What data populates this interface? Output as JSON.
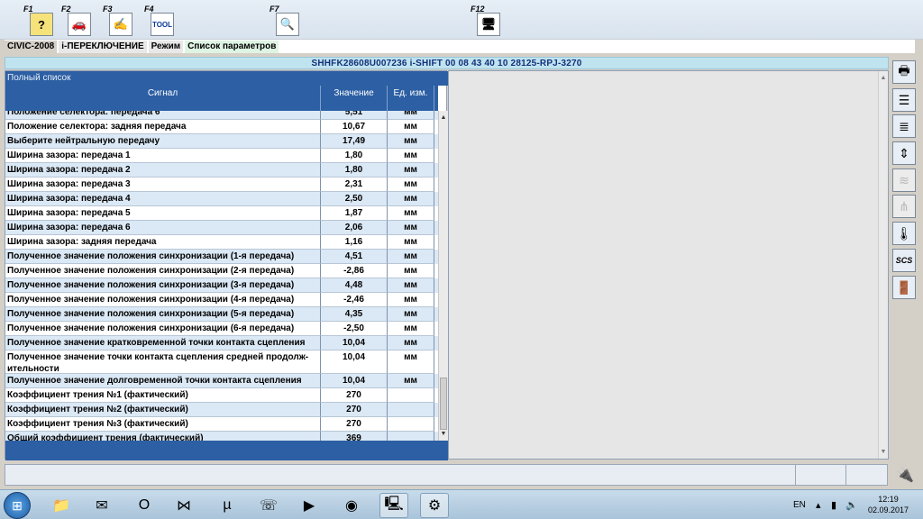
{
  "toolbar": {
    "keys": [
      {
        "label": "F1",
        "icon": "help-icon",
        "glyph": "?"
      },
      {
        "label": "F2",
        "icon": "car-icon",
        "glyph": "🚗"
      },
      {
        "label": "F3",
        "icon": "step-icon",
        "glyph": "✍"
      },
      {
        "label": "F4",
        "icon": "tool-icon",
        "glyph": "TOOL"
      },
      {
        "label": "F7",
        "icon": "test-icon",
        "glyph": "🔍"
      },
      {
        "label": "F12",
        "icon": "terminal-icon",
        "glyph": "🖥"
      }
    ]
  },
  "breadcrumb": {
    "model": "CIVIC-2008",
    "system": "i-ПЕРЕКЛЮЧЕНИЕ",
    "mode": "Режим",
    "page": "Список параметров"
  },
  "vin_line": "SHHFK28608U007236  i-SHIFT  00 08 43 40 10  28125-RPJ-3270",
  "list": {
    "title": "Полный список",
    "headers": {
      "signal": "Сигнал",
      "value": "Значение",
      "unit": "Ед. изм."
    },
    "rows": [
      {
        "signal": "Положение селектора: передача 6",
        "value": "5,51",
        "unit": "мм"
      },
      {
        "signal": "Положение селектора: задняя передача",
        "value": "10,67",
        "unit": "мм"
      },
      {
        "signal": "Выберите нейтральную передачу",
        "value": "17,49",
        "unit": "мм"
      },
      {
        "signal": "Ширина зазора: передача 1",
        "value": "1,80",
        "unit": "мм"
      },
      {
        "signal": "Ширина зазора: передача 2",
        "value": "1,80",
        "unit": "мм"
      },
      {
        "signal": "Ширина зазора: передача 3",
        "value": "2,31",
        "unit": "мм"
      },
      {
        "signal": "Ширина зазора: передача 4",
        "value": "2,50",
        "unit": "мм"
      },
      {
        "signal": "Ширина зазора: передача 5",
        "value": "1,87",
        "unit": "мм"
      },
      {
        "signal": "Ширина зазора: передача 6",
        "value": "2,06",
        "unit": "мм"
      },
      {
        "signal": "Ширина зазора: задняя передача",
        "value": "1,16",
        "unit": "мм"
      },
      {
        "signal": "Полученное значение положения синхронизации (1-я передача)",
        "value": "4,51",
        "unit": "мм"
      },
      {
        "signal": "Полученное значение положения синхронизации (2-я передача)",
        "value": "-2,86",
        "unit": "мм"
      },
      {
        "signal": "Полученное значение положения синхронизации (3-я передача)",
        "value": "4,48",
        "unit": "мм"
      },
      {
        "signal": "Полученное значение положения синхронизации (4-я передача)",
        "value": "-2,46",
        "unit": "мм"
      },
      {
        "signal": "Полученное значение положения синхронизации (5-я передача)",
        "value": "4,35",
        "unit": "мм"
      },
      {
        "signal": "Полученное значение положения синхронизации (6-я передача)",
        "value": "-2,50",
        "unit": "мм"
      },
      {
        "signal": "Полученное значение кратковременной точки контакта сцепления",
        "value": "10,04",
        "unit": "мм"
      },
      {
        "signal": "Полученное значение точки контакта сцепления средней продолж-ительности",
        "value": "10,04",
        "unit": "мм"
      },
      {
        "signal": "Полученное значение долговременной точки контакта сцепления",
        "value": "10,04",
        "unit": "мм"
      },
      {
        "signal": "Коэффициент трения №1 (фактический)",
        "value": "270",
        "unit": ""
      },
      {
        "signal": "Коэффициент трения №2 (фактический)",
        "value": "270",
        "unit": ""
      },
      {
        "signal": "Коэффициент трения №3 (фактический)",
        "value": "270",
        "unit": ""
      },
      {
        "signal": "Общий коэффициент трения (фактический)",
        "value": "369",
        "unit": ""
      }
    ]
  },
  "side_tools": [
    {
      "icon": "printer-icon",
      "glyph": "🖶",
      "enabled": true
    },
    {
      "icon": "select-icon",
      "glyph": "☰",
      "enabled": true
    },
    {
      "icon": "list-icon",
      "glyph": "≣",
      "enabled": true
    },
    {
      "icon": "sort-icon",
      "glyph": "⇕",
      "enabled": true
    },
    {
      "icon": "graph-icon",
      "glyph": "≋",
      "enabled": false
    },
    {
      "icon": "filter-icon",
      "glyph": "⋔",
      "enabled": false
    },
    {
      "icon": "thermometer-icon",
      "glyph": "🌡",
      "enabled": true
    },
    {
      "icon": "scs-icon",
      "glyph": "SCS",
      "enabled": true
    },
    {
      "icon": "exit-icon",
      "glyph": "🚪",
      "enabled": true
    }
  ],
  "taskbar": {
    "apps": [
      {
        "icon": "explorer-icon",
        "glyph": "📁"
      },
      {
        "icon": "mail-icon",
        "glyph": "✉"
      },
      {
        "icon": "opera-icon",
        "glyph": "O"
      },
      {
        "icon": "visual-studio-icon",
        "glyph": "⋈"
      },
      {
        "icon": "utorrent-icon",
        "glyph": "µ"
      },
      {
        "icon": "viber-icon",
        "glyph": "☏"
      },
      {
        "icon": "media-player-icon",
        "glyph": "▶"
      },
      {
        "icon": "chrome-icon",
        "glyph": "◉"
      },
      {
        "icon": "diagnostic-app-icon",
        "glyph": "🖳"
      },
      {
        "icon": "honda-hds-icon",
        "glyph": "⚙"
      }
    ],
    "language": "EN",
    "time": "12:19",
    "date": "02.09.2017"
  },
  "colors": {
    "header_blue": "#2c5fa3",
    "row_alt": "#dbe8f5",
    "vin_bar": "#bfe3ef"
  }
}
